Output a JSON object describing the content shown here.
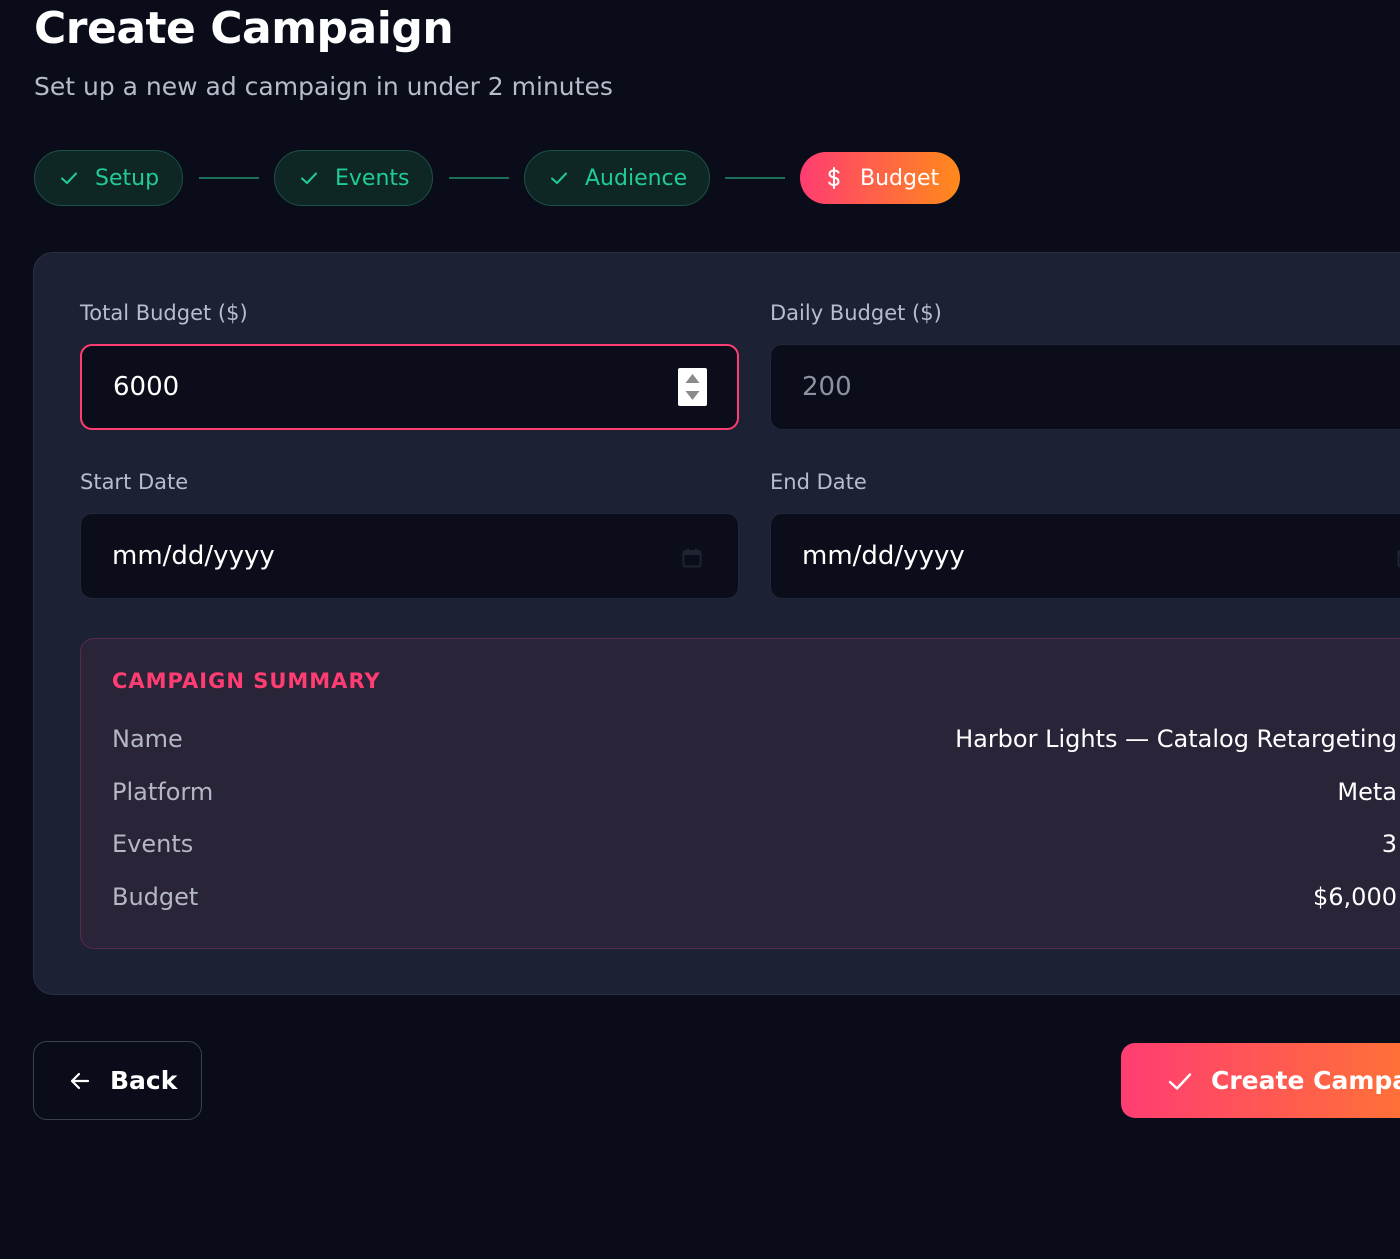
{
  "header": {
    "title": "Create Campaign",
    "subtitle": "Set up a new ad campaign in under 2 minutes"
  },
  "stepper": {
    "steps": [
      {
        "label": "Setup",
        "status": "complete",
        "icon": "check-icon"
      },
      {
        "label": "Events",
        "status": "complete",
        "icon": "check-icon"
      },
      {
        "label": "Audience",
        "status": "complete",
        "icon": "check-icon"
      },
      {
        "label": "Budget",
        "status": "active",
        "icon": "dollar-icon"
      }
    ]
  },
  "form": {
    "total_budget": {
      "label": "Total Budget ($)",
      "value": "6000"
    },
    "daily_budget": {
      "label": "Daily Budget ($)",
      "placeholder": "200"
    },
    "start_date": {
      "label": "Start Date",
      "placeholder": "mm/dd/yyyy"
    },
    "end_date": {
      "label": "End Date",
      "placeholder": "mm/dd/yyyy"
    }
  },
  "summary": {
    "title": "CAMPAIGN SUMMARY",
    "rows": [
      {
        "label": "Name",
        "value": "Harbor Lights — Catalog Retargeting"
      },
      {
        "label": "Platform",
        "value": "Meta"
      },
      {
        "label": "Events",
        "value": "3"
      },
      {
        "label": "Budget",
        "value": "$6,000"
      }
    ]
  },
  "actions": {
    "back_label": "Back",
    "create_label": "Create Campaign"
  },
  "colors": {
    "background": "#0a0c1a",
    "panel": "#1c2133",
    "accent_pink": "#ff3d72",
    "accent_orange": "#ff8a1a",
    "success_green": "#20cc93",
    "summary_bg": "#2a2438"
  }
}
